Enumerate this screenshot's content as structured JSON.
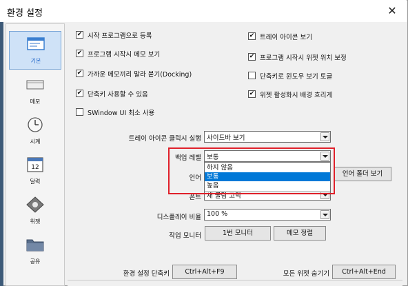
{
  "window": {
    "title": "환경 설정",
    "close_glyph": "✕"
  },
  "sidebar": {
    "items": [
      {
        "label": "기본",
        "icon": "general-settings-icon",
        "selected": true
      },
      {
        "label": "메모",
        "icon": "memo-icon",
        "selected": false
      },
      {
        "label": "시계",
        "icon": "clock-icon",
        "selected": false
      },
      {
        "label": "달력",
        "icon": "calendar-icon",
        "selected": false
      },
      {
        "label": "위젯",
        "icon": "widget-icon",
        "selected": false
      },
      {
        "label": "공유",
        "icon": "folder-share-icon",
        "selected": false
      }
    ],
    "calendar_icon_text": "12"
  },
  "checkboxes": {
    "left": [
      {
        "label": "시작 프로그램으로 등록",
        "checked": true
      },
      {
        "label": "프로그램 시작시 메모 보기",
        "checked": true
      },
      {
        "label": "가까운 메모끼리 말라 붙기(Docking)",
        "checked": true
      },
      {
        "label": "단축키 사용할 수 있음",
        "checked": true
      },
      {
        "label": "SWindow UI 최소 사용",
        "checked": false
      }
    ],
    "right": [
      {
        "label": "트레이 아이콘 보기",
        "checked": true
      },
      {
        "label": "프로그램 시작시 위젯 위치 보정",
        "checked": true
      },
      {
        "label": "단축키로 윈도우 보기 토글",
        "checked": false
      },
      {
        "label": "위젯 활성화시 배경 흐리게",
        "checked": true
      }
    ]
  },
  "check_mark": "✔",
  "tray_click": {
    "label": "트레이 아이콘 클릭시 실행",
    "value": "사이드바 보기"
  },
  "backup_level": {
    "label": "백업 레벨",
    "value": "보통",
    "options": [
      "하지 않음",
      "보통",
      "높음"
    ],
    "selected_index": 1
  },
  "language": {
    "label": "언어",
    "folder_button": "언어 폴더 보기"
  },
  "font": {
    "label": "폰트",
    "value": "새 굴림 고딕"
  },
  "display_ratio": {
    "label": "디스플레이 비율",
    "value": "100 %"
  },
  "monitor": {
    "label": "작업 모니터",
    "button1": "1번 모니터",
    "button2": "메모 정렬"
  },
  "hotkeys": {
    "settings_label": "환경 설정 단축키",
    "settings_value": "Ctrl+Alt+F9",
    "hide_label": "모든 위젯 숨기기",
    "hide_value": "Ctrl+Alt+End"
  },
  "colors": {
    "highlight": "#e0202a",
    "selection": "#0078d7",
    "sidebar_selected": "#cfe2f7"
  }
}
